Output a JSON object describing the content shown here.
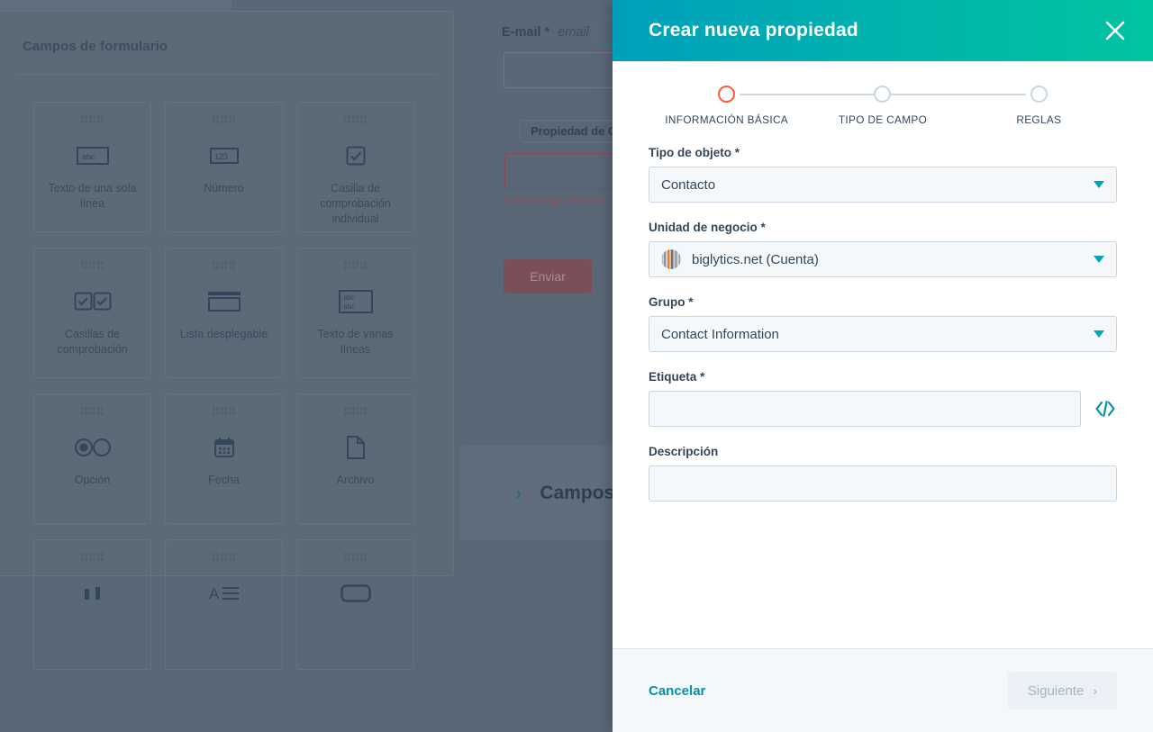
{
  "background": {
    "panel_title": "Campos de formulario",
    "field_cards": [
      {
        "label": "Texto de una sola línea",
        "icon": "text-box-abc-icon"
      },
      {
        "label": "Número",
        "icon": "number-box-123-icon"
      },
      {
        "label": "Casilla de comprobación individual",
        "icon": "single-checkbox-icon"
      },
      {
        "label": "Casillas de comprobación",
        "icon": "multi-checkbox-icon"
      },
      {
        "label": "Lista desplegable",
        "icon": "dropdown-icon"
      },
      {
        "label": "Texto de varias líneas",
        "icon": "multiline-text-icon"
      },
      {
        "label": "Opción",
        "icon": "radio-option-icon"
      },
      {
        "label": "Fecha",
        "icon": "calendar-icon"
      },
      {
        "label": "Archivo",
        "icon": "file-icon"
      },
      {
        "label": "",
        "icon": "toggle-icon"
      },
      {
        "label": "",
        "icon": "rich-text-icon"
      },
      {
        "label": "",
        "icon": "button-icon"
      }
    ],
    "email_label": "E-mail *",
    "email_value": "email",
    "chip_label": "Propiedad de C",
    "error_text": "Este campo tiene un",
    "submit_label": "Enviar",
    "lower_card_label": "Campos"
  },
  "modal": {
    "title": "Crear nueva propiedad",
    "close_icon": "close-icon",
    "steps": [
      {
        "label": "INFORMACIÓN BÁSICA",
        "active": true
      },
      {
        "label": "TIPO DE CAMPO",
        "active": false
      },
      {
        "label": "REGLAS",
        "active": false
      }
    ],
    "fields": {
      "object_type": {
        "label": "Tipo de objeto *",
        "value": "Contacto",
        "icon": "chevron-down-icon"
      },
      "business_unit": {
        "label": "Unidad de negocio *",
        "value": "biglytics.net (Cuenta)",
        "avatar": "biglytics-avatar",
        "icon": "chevron-down-icon"
      },
      "group": {
        "label": "Grupo *",
        "value": "Contact Information",
        "icon": "chevron-down-icon"
      },
      "etiqueta": {
        "label": "Etiqueta *",
        "value": "",
        "placeholder": "",
        "code_icon": "code-brackets-icon"
      },
      "descripcion": {
        "label": "Descripción",
        "value": "",
        "placeholder": ""
      }
    },
    "footer": {
      "cancel_label": "Cancelar",
      "next_label": "Siguiente",
      "next_chevron": "›"
    }
  },
  "colors": {
    "header_gradient_start": "#009fbb",
    "header_gradient_end": "#00c4a0",
    "accent_teal": "#00a4bd",
    "active_step": "#ff5c35",
    "link": "#0091ae",
    "text": "#33475b",
    "overlay": "#5a6776"
  }
}
